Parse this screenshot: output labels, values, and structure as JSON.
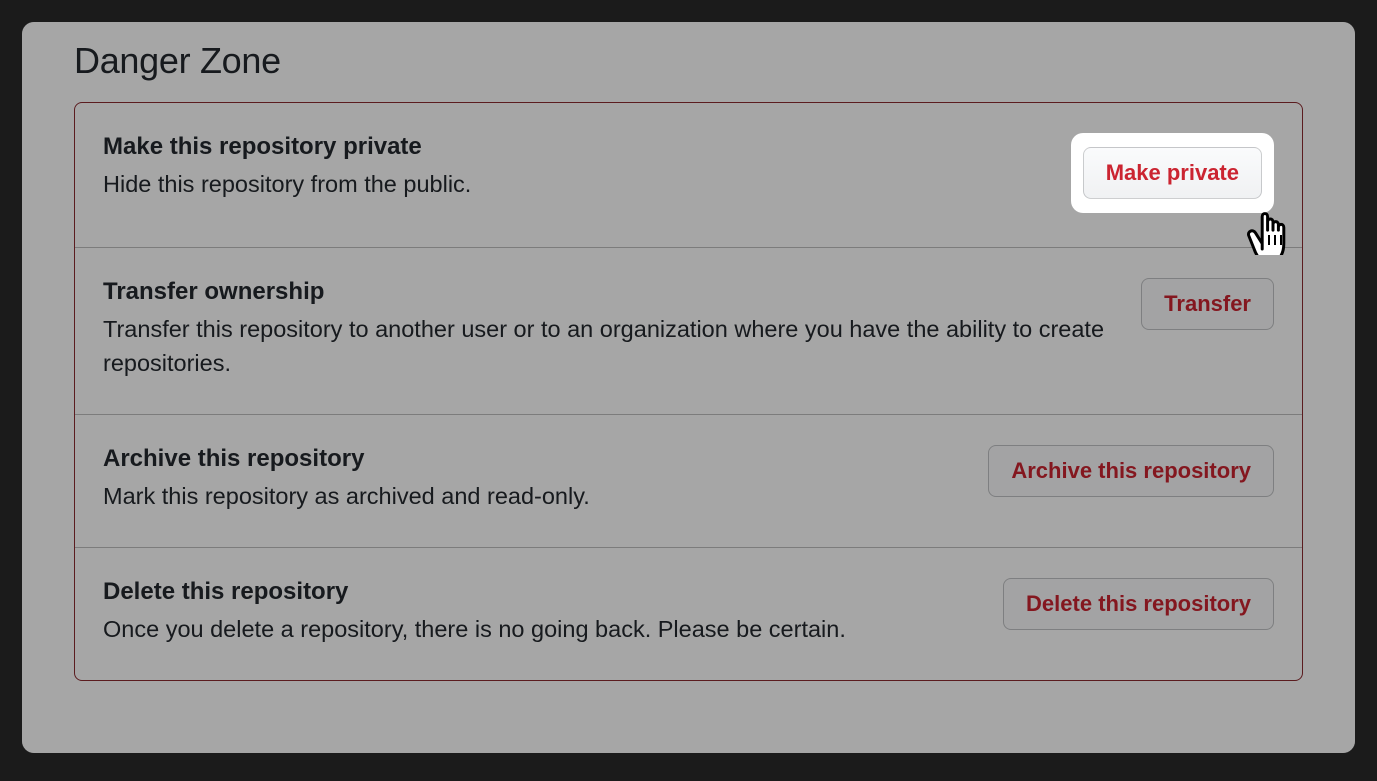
{
  "section": {
    "title": "Danger Zone"
  },
  "rows": [
    {
      "title": "Make this repository private",
      "desc": "Hide this repository from the public.",
      "button": "Make private"
    },
    {
      "title": "Transfer ownership",
      "desc": "Transfer this repository to another user or to an organization where you have the ability to create repositories.",
      "button": "Transfer"
    },
    {
      "title": "Archive this repository",
      "desc": "Mark this repository as archived and read-only.",
      "button": "Archive this repository"
    },
    {
      "title": "Delete this repository",
      "desc": "Once you delete a repository, there is no going back. Please be certain.",
      "button": "Delete this repository"
    }
  ]
}
